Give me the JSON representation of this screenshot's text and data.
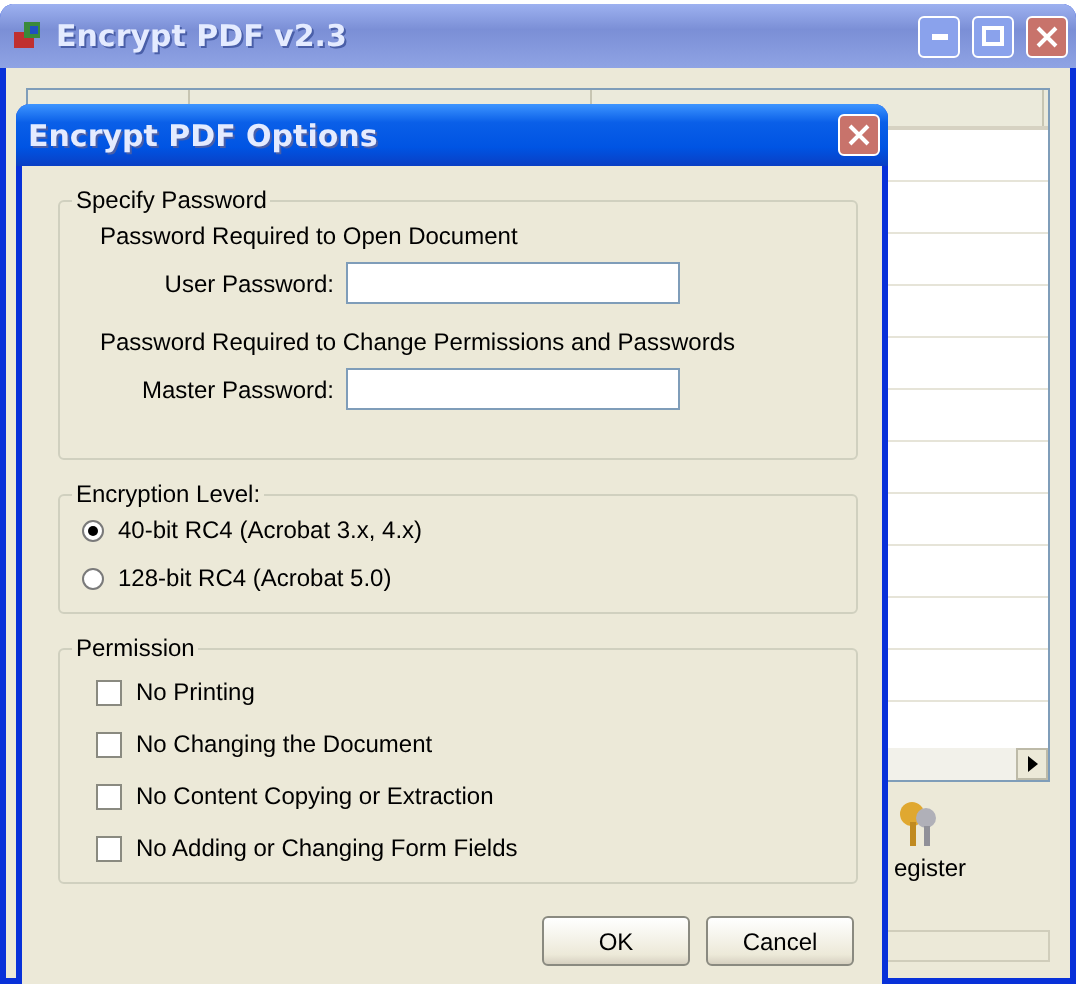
{
  "main_window": {
    "title": "Encrypt PDF v2.3",
    "register_label": "egister"
  },
  "dialog": {
    "title": "Encrypt PDF Options",
    "password_group": {
      "title": "Specify Password",
      "open_heading": "Password Required to Open Document",
      "user_label": "User Password:",
      "perm_heading": "Password Required to Change Permissions and Passwords",
      "master_label": "Master Password:"
    },
    "encryption_group": {
      "title": "Encryption Level:",
      "options": [
        {
          "label": "40-bit RC4 (Acrobat 3.x, 4.x)",
          "selected": true
        },
        {
          "label": "128-bit RC4 (Acrobat 5.0)",
          "selected": false
        }
      ]
    },
    "permission_group": {
      "title": "Permission",
      "options": [
        {
          "label": "No Printing",
          "checked": false
        },
        {
          "label": "No Changing the Document",
          "checked": false
        },
        {
          "label": "No Content Copying or Extraction",
          "checked": false
        },
        {
          "label": "No Adding or Changing Form Fields",
          "checked": false
        }
      ]
    },
    "buttons": [
      "OK",
      "Cancel"
    ]
  }
}
